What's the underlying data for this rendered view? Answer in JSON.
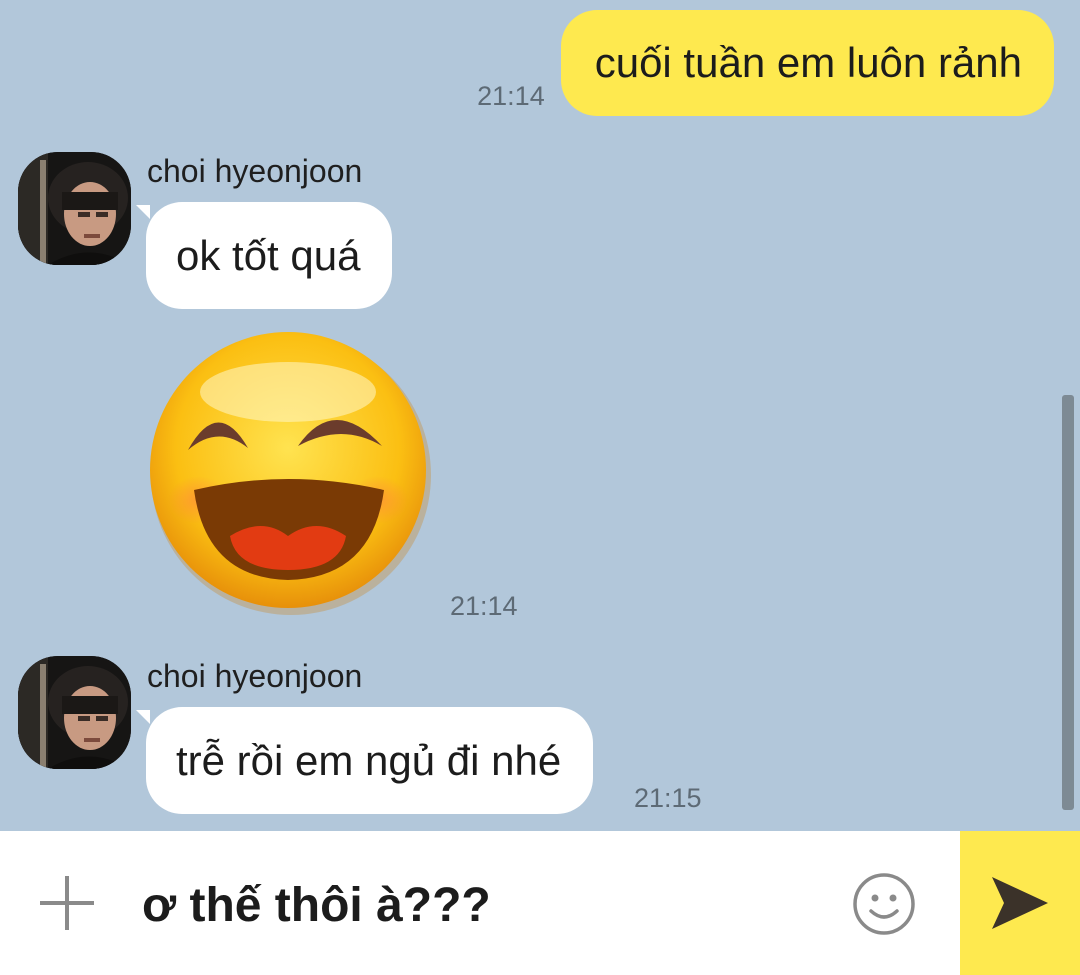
{
  "colors": {
    "chat_background": "#b2c7da",
    "outgoing_bubble": "#fee94f",
    "incoming_bubble": "#ffffff",
    "send_button": "#fee94f"
  },
  "messages": [
    {
      "direction": "outgoing",
      "text": "cuối tuần em luôn rảnh",
      "time": "21:14"
    },
    {
      "direction": "incoming",
      "sender": "choi hyeonjoon",
      "text": "ok tốt quá",
      "sticker": "laughing-face-emoticon",
      "time": "21:14"
    },
    {
      "direction": "incoming",
      "sender": "choi hyeonjoon",
      "text": "trễ rồi em ngủ đi nhé",
      "time": "21:15"
    }
  ],
  "composer": {
    "input_value": "ơ thế thôi à???",
    "plus_icon": "plus-icon",
    "emoji_icon": "smiley-icon",
    "send_icon": "send-arrow-icon"
  }
}
